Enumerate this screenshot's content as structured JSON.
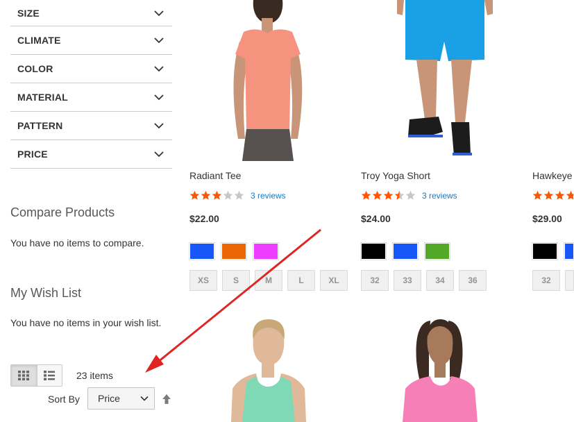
{
  "filters": [
    {
      "label": "SIZE"
    },
    {
      "label": "CLIMATE"
    },
    {
      "label": "COLOR"
    },
    {
      "label": "MATERIAL"
    },
    {
      "label": "PATTERN"
    },
    {
      "label": "PRICE"
    }
  ],
  "compare": {
    "title": "Compare Products",
    "empty_text": "You have no items to compare."
  },
  "wishlist": {
    "title": "My Wish List",
    "empty_text": "You have no items in your wish list."
  },
  "toolbar": {
    "items_count": "23 items",
    "sort_label": "Sort By",
    "sort_value": "Price",
    "grid_icon": "grid-icon",
    "list_icon": "list-icon",
    "sort_direction_icon": "arrow-up-icon"
  },
  "colors": {
    "star_filled": "#ff5501",
    "star_empty": "#c7c7c7",
    "link": "#1979c3",
    "annotation_arrow": "#e02424"
  },
  "products": [
    {
      "name": "Radiant Tee",
      "rating_fraction": 0.6,
      "reviews": "3 reviews",
      "price": "$22.00",
      "colors": [
        "#1857f7",
        "#eb6703",
        "#ef3dff"
      ],
      "sizes": [
        "XS",
        "S",
        "M",
        "L",
        "XL"
      ]
    },
    {
      "name": "Troy Yoga Short",
      "rating_fraction": 0.7,
      "reviews": "3 reviews",
      "price": "$24.00",
      "colors": [
        "#000000",
        "#1857f7",
        "#53a828"
      ],
      "sizes": [
        "32",
        "33",
        "34",
        "36"
      ]
    },
    {
      "name": "Hawkeye",
      "rating_fraction": 0.75,
      "reviews": "",
      "price": "$29.00",
      "colors": [
        "#000000",
        "#1857f7"
      ],
      "sizes": [
        "32",
        ""
      ]
    }
  ]
}
